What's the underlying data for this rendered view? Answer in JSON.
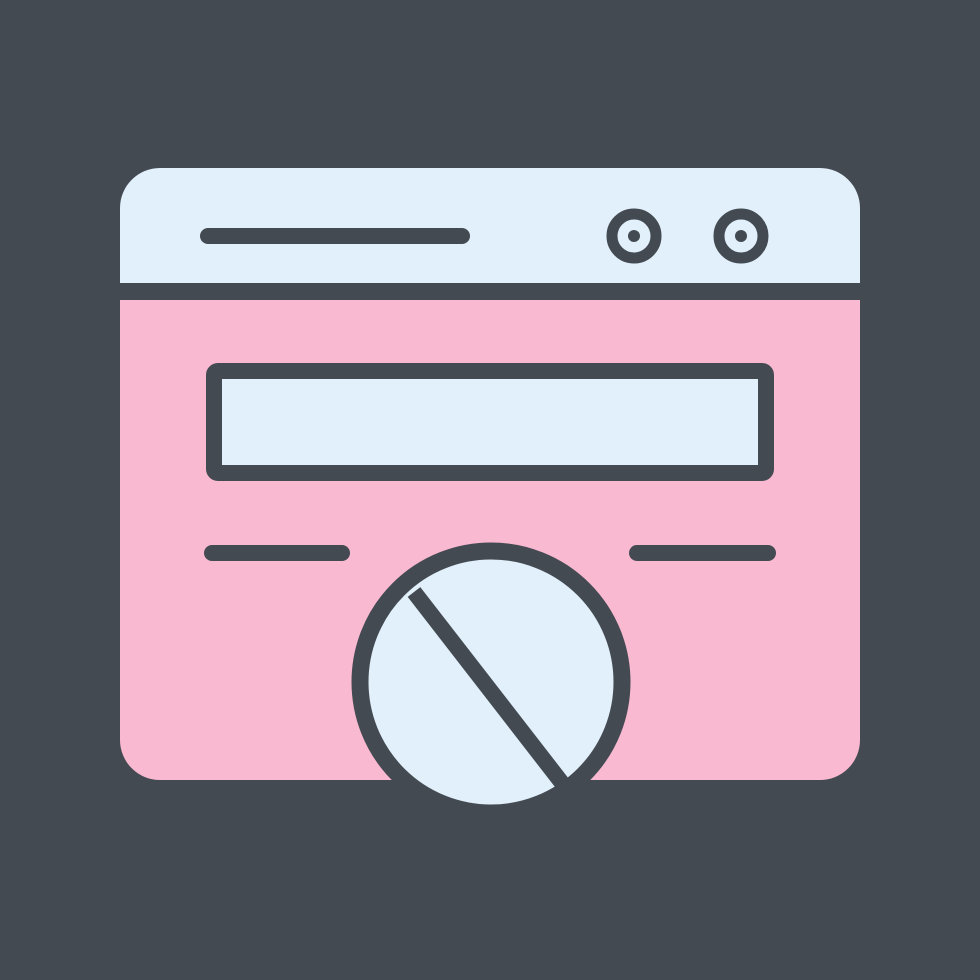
{
  "icon": {
    "name": "blocked-webpage-icon",
    "colors": {
      "background": "#444a52",
      "header_fill": "#e1f0fb",
      "body_fill": "#f9b9d0",
      "outline": "#444a52",
      "field_fill": "#e1f0fb",
      "block_fill": "#e1f0fb"
    },
    "parts": [
      "browser-window",
      "title-bar-line",
      "window-control-dot",
      "window-control-dot",
      "content-field",
      "text-line",
      "text-line",
      "blocked-sign"
    ]
  }
}
